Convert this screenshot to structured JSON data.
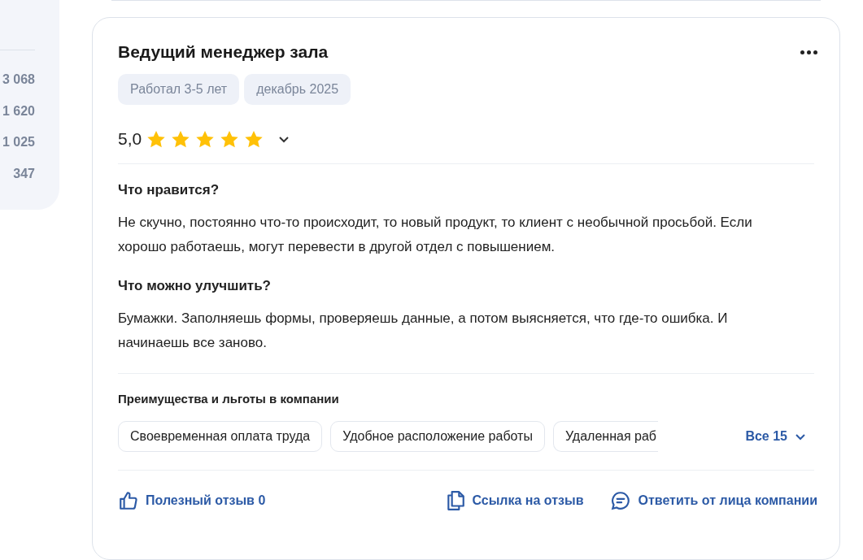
{
  "side_counts": [
    "3 068",
    "1 620",
    "1 025",
    "347"
  ],
  "review": {
    "title": "Ведущий менеджер зала",
    "tags": [
      "Работал 3-5 лет",
      "декабрь 2025"
    ],
    "rating": "5,0",
    "stars": 5,
    "expanded": false,
    "sections": [
      {
        "heading": "Что нравится?",
        "text": "Не скучно, постоянно что-то происходит, то новый продукт, то клиент с необычной просьбой. Если хорошо работаешь, могут перевести в другой отдел с повышением."
      },
      {
        "heading": "Что можно улучшить?",
        "text": "Бумажки. Заполняешь формы, проверяешь данные, а потом выясняется, что где-то ошибка. И начинаешь все заново."
      }
    ],
    "benefits_heading": "Преимущества и льготы в компании",
    "benefits": [
      {
        "label": "Своевременная оплата труда",
        "cut": false
      },
      {
        "label": "Удобное расположение работы",
        "cut": false
      },
      {
        "label": "Удаленная раб",
        "cut": true
      }
    ],
    "benefits_more": "Все 15",
    "actions": [
      {
        "kind": "like",
        "label": "Полезный отзыв 0"
      },
      {
        "kind": "link",
        "label": "Ссылка на отзыв"
      },
      {
        "kind": "reply",
        "label": "Ответить от лица компании"
      }
    ]
  }
}
